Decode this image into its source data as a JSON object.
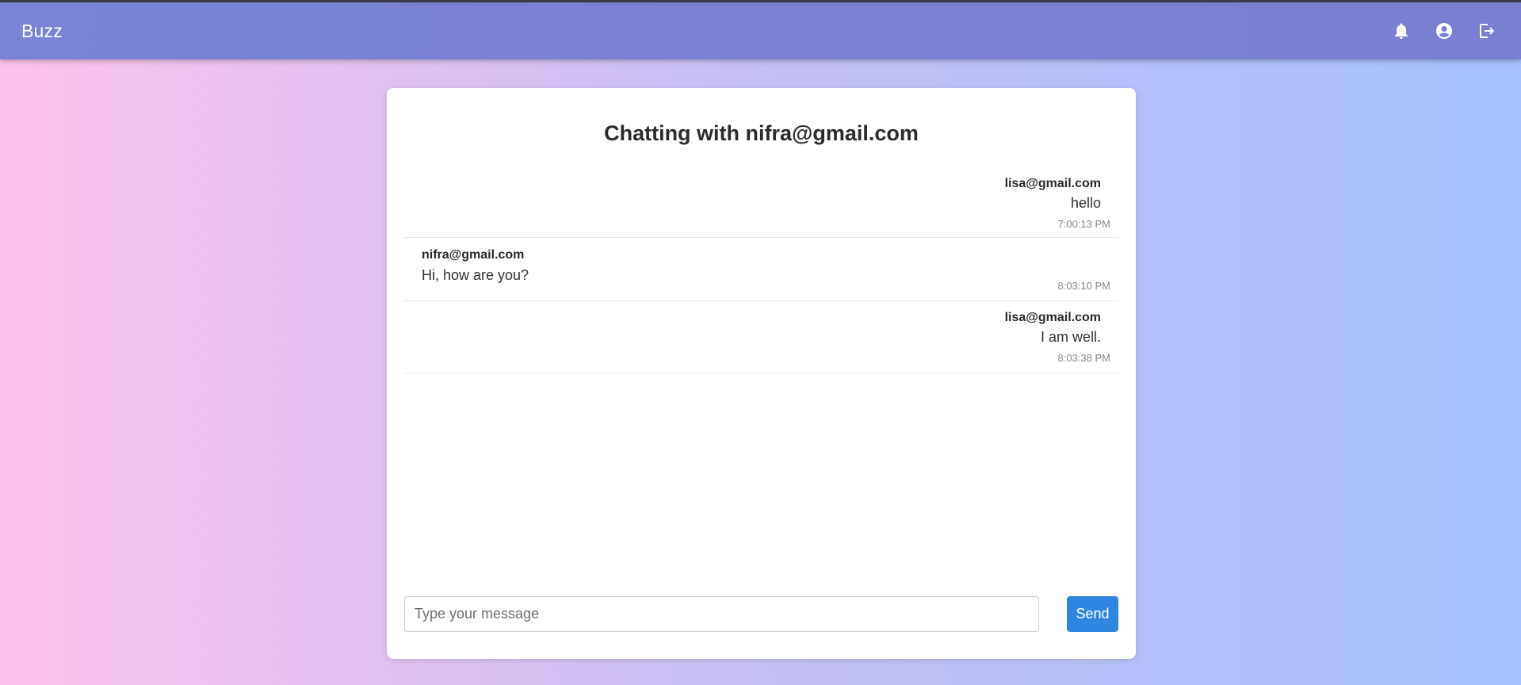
{
  "app": {
    "brand": "Buzz"
  },
  "navbar": {
    "icons": [
      "bell-icon",
      "user-circle-icon",
      "logout-icon"
    ]
  },
  "chat": {
    "title": "Chatting with nifra@gmail.com",
    "messages": [
      {
        "sender": "lisa@gmail.com",
        "text": "hello",
        "time": "7:00:13 PM",
        "side": "right"
      },
      {
        "sender": "nifra@gmail.com",
        "text": "Hi, how are you?",
        "time": "8:03:10 PM",
        "side": "left"
      },
      {
        "sender": "lisa@gmail.com",
        "text": "I am well.",
        "time": "8:03:38 PM",
        "side": "right"
      }
    ]
  },
  "composer": {
    "placeholder": "Type your message",
    "value": "",
    "send_label": "Send"
  },
  "colors": {
    "navbar": "#7a80d4",
    "send_button": "#2f86e0",
    "background_left": "#fbc2eb",
    "background_right": "#a6c1ff"
  }
}
